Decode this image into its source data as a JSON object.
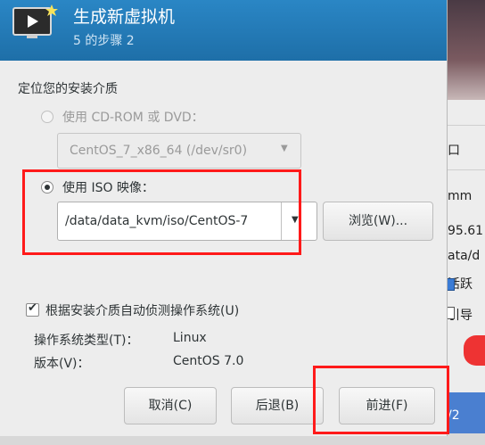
{
  "dialog": {
    "title": "生成新虚拟机",
    "step": "5 的步骤 2"
  },
  "section_label": "定位您的安装介质",
  "cdrom": {
    "label": "使用 CD-ROM 或 DVD：",
    "device": "CentOS_7_x86_64 (/dev/sr0)"
  },
  "iso": {
    "label": "使用 ISO 映像：",
    "path": "/data/data_kvm/iso/CentOS-7",
    "browse_label": "浏览(W)..."
  },
  "auto_detect": {
    "label": "根据安装介质自动侦测操作系统(U)",
    "checked": true
  },
  "os_info": {
    "type_label": "操作系统类型(T)：",
    "type_value": "Linux",
    "version_label": "版本(V)：",
    "version_value": "CentOS 7.0"
  },
  "buttons": {
    "cancel": "取消(C)",
    "back": "后退(B)",
    "forward": "前进(F)"
  },
  "background": {
    "texts": [
      "口",
      "mm",
      "95.61",
      "ata/d",
      "活跃",
      "引导",
      "/2"
    ]
  },
  "colors": {
    "header": "#1f77b4",
    "highlight": "#ff1a1a"
  }
}
